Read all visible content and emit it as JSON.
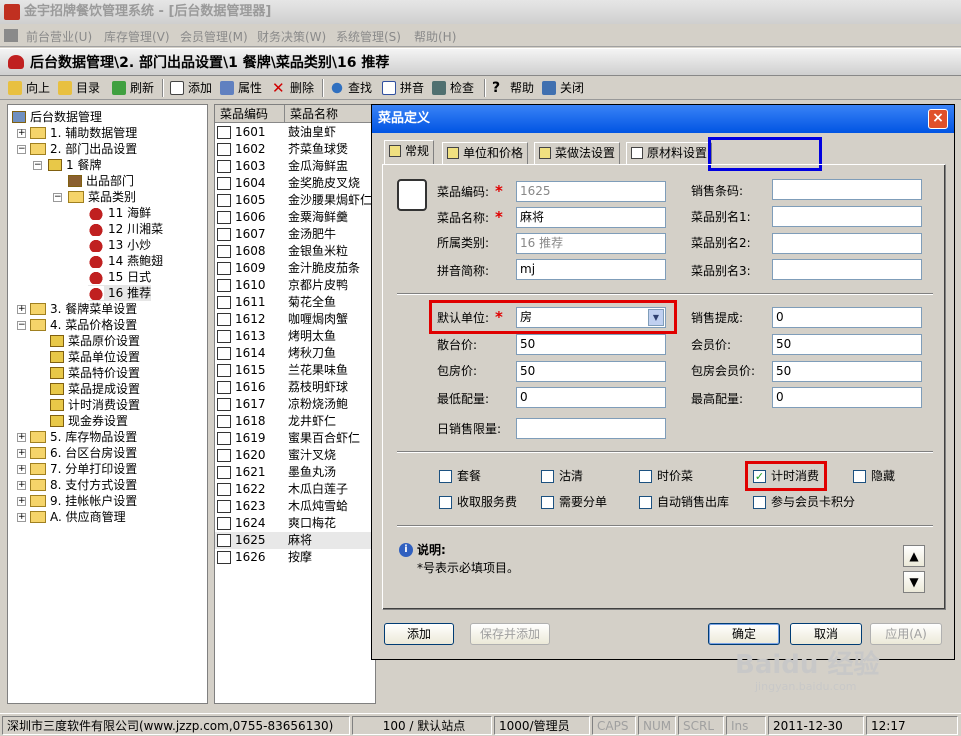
{
  "window": {
    "title": "金宇招牌餐饮管理系统 - [后台数据管理器]"
  },
  "menu": [
    "前台营业(U)",
    "库存管理(V)",
    "会员管理(M)",
    "财务决策(W)",
    "系统管理(S)",
    "帮助(H)"
  ],
  "path": "后台数据管理\\2. 部门出品设置\\1 餐牌\\菜品类别\\16 推荐",
  "toolbar": [
    "向上",
    "目录",
    "刷新",
    "添加",
    "属性",
    "删除",
    "查找",
    "拼音",
    "检查",
    "帮助",
    "关闭"
  ],
  "tree": {
    "root": "后台数据管理",
    "n1": "1. 辅助数据管理",
    "n2": "2. 部门出品设置",
    "n2_1": "1 餐牌",
    "n2_1_1": "出品部门",
    "n2_1_2": "菜品类别",
    "c11": "11 海鲜",
    "c12": "12 川湘菜",
    "c13": "13 小炒",
    "c14": "14 燕鲍翅",
    "c15": "15 日式",
    "c16": "16 推荐",
    "n3": "3. 餐牌菜单设置",
    "n4": "4. 菜品价格设置",
    "n4_1": "菜品原价设置",
    "n4_2": "菜品单位设置",
    "n4_3": "菜品特价设置",
    "n4_4": "菜品提成设置",
    "n4_5": "计时消费设置",
    "n4_6": "现金券设置",
    "n5": "5. 库存物品设置",
    "n6": "6. 台区台房设置",
    "n7": "7. 分单打印设置",
    "n8": "8. 支付方式设置",
    "n9": "9. 挂帐帐户设置",
    "nA": "A. 供应商管理"
  },
  "list": {
    "col_code": "菜品编码",
    "col_name": "菜品名称",
    "rows": [
      {
        "code": "1601",
        "name": "鼓油皇虾"
      },
      {
        "code": "1602",
        "name": "芥菜鱼球煲"
      },
      {
        "code": "1603",
        "name": "金瓜海鲜盅"
      },
      {
        "code": "1604",
        "name": "金奖脆皮叉烧"
      },
      {
        "code": "1605",
        "name": "金沙腰果焗虾仁"
      },
      {
        "code": "1606",
        "name": "金粟海鲜羹"
      },
      {
        "code": "1607",
        "name": "金汤肥牛"
      },
      {
        "code": "1608",
        "name": "金银鱼米粒"
      },
      {
        "code": "1609",
        "name": "金汁脆皮茄条"
      },
      {
        "code": "1610",
        "name": "京都片皮鸭"
      },
      {
        "code": "1611",
        "name": "菊花全鱼"
      },
      {
        "code": "1612",
        "name": "咖喱焗肉蟹"
      },
      {
        "code": "1613",
        "name": "烤明太鱼"
      },
      {
        "code": "1614",
        "name": "烤秋刀鱼"
      },
      {
        "code": "1615",
        "name": "兰花果味鱼"
      },
      {
        "code": "1616",
        "name": "荔枝明虾球"
      },
      {
        "code": "1617",
        "name": "凉粉烧汤鲍"
      },
      {
        "code": "1618",
        "name": "龙井虾仁"
      },
      {
        "code": "1619",
        "name": "蜜果百合虾仁"
      },
      {
        "code": "1620",
        "name": "蜜汁叉烧"
      },
      {
        "code": "1621",
        "name": "墨鱼丸汤"
      },
      {
        "code": "1622",
        "name": "木瓜白莲子"
      },
      {
        "code": "1623",
        "name": "木瓜炖雪蛤"
      },
      {
        "code": "1624",
        "name": "爽口梅花"
      },
      {
        "code": "1625",
        "name": "麻将"
      },
      {
        "code": "1626",
        "name": "按摩"
      }
    ]
  },
  "dialog": {
    "title": "菜品定义",
    "close": "×",
    "tabs": [
      "常规",
      "单位和价格",
      "菜做法设置",
      "原材料设置"
    ],
    "labels": {
      "code": "菜品编码:",
      "name": "菜品名称:",
      "category": "所属类别:",
      "pinyin": "拼音简称:",
      "barcode": "销售条码:",
      "alias1": "菜品别名1:",
      "alias2": "菜品别名2:",
      "alias3": "菜品别名3:",
      "unit": "默认单位:",
      "commission": "销售提成:",
      "retail": "散台价:",
      "member": "会员价:",
      "room": "包房价:",
      "room_member": "包房会员价:",
      "min_qty": "最低配量:",
      "max_qty": "最高配量:",
      "daily_limit": "日销售限量:"
    },
    "required": "*",
    "values": {
      "code": "1625",
      "name": "麻将",
      "category": "16 推荐",
      "pinyin": "mj",
      "barcode": "",
      "alias1": "",
      "alias2": "",
      "alias3": "",
      "unit": "房",
      "commission": "0",
      "retail": "50",
      "member": "50",
      "room": "50",
      "room_member": "50",
      "min_qty": "0",
      "max_qty": "0",
      "daily_limit": ""
    },
    "checkboxes": [
      {
        "label": "套餐",
        "checked": false
      },
      {
        "label": "沽清",
        "checked": false
      },
      {
        "label": "时价菜",
        "checked": false
      },
      {
        "label": "计时消费",
        "checked": true
      },
      {
        "label": "隐藏",
        "checked": false
      },
      {
        "label": "收取服务费",
        "checked": false
      },
      {
        "label": "需要分单",
        "checked": false
      },
      {
        "label": "自动销售出库",
        "checked": false
      },
      {
        "label": "参与会员卡积分",
        "checked": false
      }
    ],
    "note_title": "说明:",
    "note_text": "*号表示必填项目。",
    "buttons": {
      "add": "添加",
      "save_add": "保存并添加",
      "ok": "确定",
      "cancel": "取消",
      "apply": "应用(A)"
    },
    "up_arrow": "▲",
    "down_arrow": "▼"
  },
  "status": [
    "深圳市三度软件有限公司(www.jzzp.com,0755-83656130)",
    "100 / 默认站点",
    "1000/管理员",
    "CAPS",
    "NUM",
    "SCRL",
    "Ins",
    "2011-12-30",
    "12:17"
  ],
  "watermark": {
    "brand": "Baidu 经验",
    "url": "jingyan.baidu.com"
  },
  "colors": {
    "title_active": "#0054e3",
    "highlight_red": "#e00000",
    "highlight_blue": "#0000e0",
    "check_green": "#21a121"
  }
}
